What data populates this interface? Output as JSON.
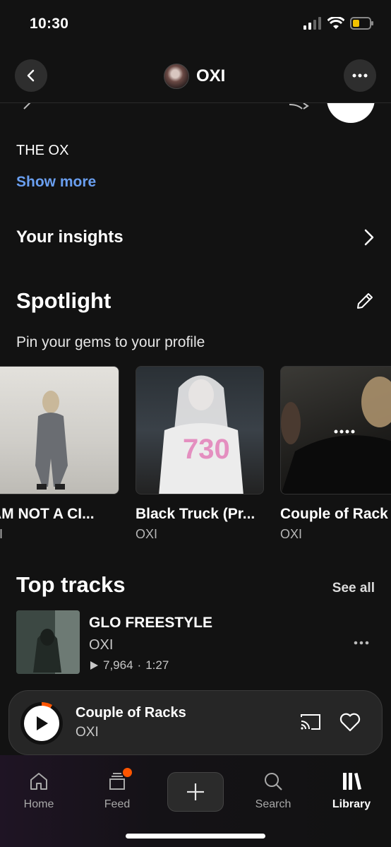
{
  "status_bar": {
    "time": "10:30"
  },
  "header": {
    "title": "OXI"
  },
  "profile": {
    "bio": "THE OX",
    "show_more_label": "Show more"
  },
  "insights": {
    "label": "Your insights"
  },
  "spotlight": {
    "title": "Spotlight",
    "subtitle": "Pin your gems to your profile",
    "items": [
      {
        "title": "AM NOT A CI...",
        "artist": "XI"
      },
      {
        "title": "Black Truck (Pr...",
        "artist": "OXI"
      },
      {
        "title": "Couple of Rack",
        "artist": "OXI"
      }
    ]
  },
  "top_tracks": {
    "title": "Top tracks",
    "see_all_label": "See all",
    "items": [
      {
        "title": "GLO FREESTYLE",
        "artist": "OXI",
        "plays": "7,964",
        "separator": "·",
        "duration": "1:27"
      }
    ]
  },
  "mini_player": {
    "title": "Couple of Racks",
    "artist": "OXI"
  },
  "tab_bar": {
    "home": "Home",
    "feed": "Feed",
    "search": "Search",
    "library": "Library",
    "active": "library"
  },
  "colors": {
    "accent": "#ff5500",
    "link": "#6a9ff0",
    "background": "#121212"
  },
  "icons": [
    "back-icon",
    "more-icon",
    "chevron-right-icon",
    "pencil-icon",
    "play-icon",
    "cast-icon",
    "heart-icon",
    "home-icon",
    "feed-icon",
    "plus-icon",
    "search-icon",
    "library-icon"
  ]
}
